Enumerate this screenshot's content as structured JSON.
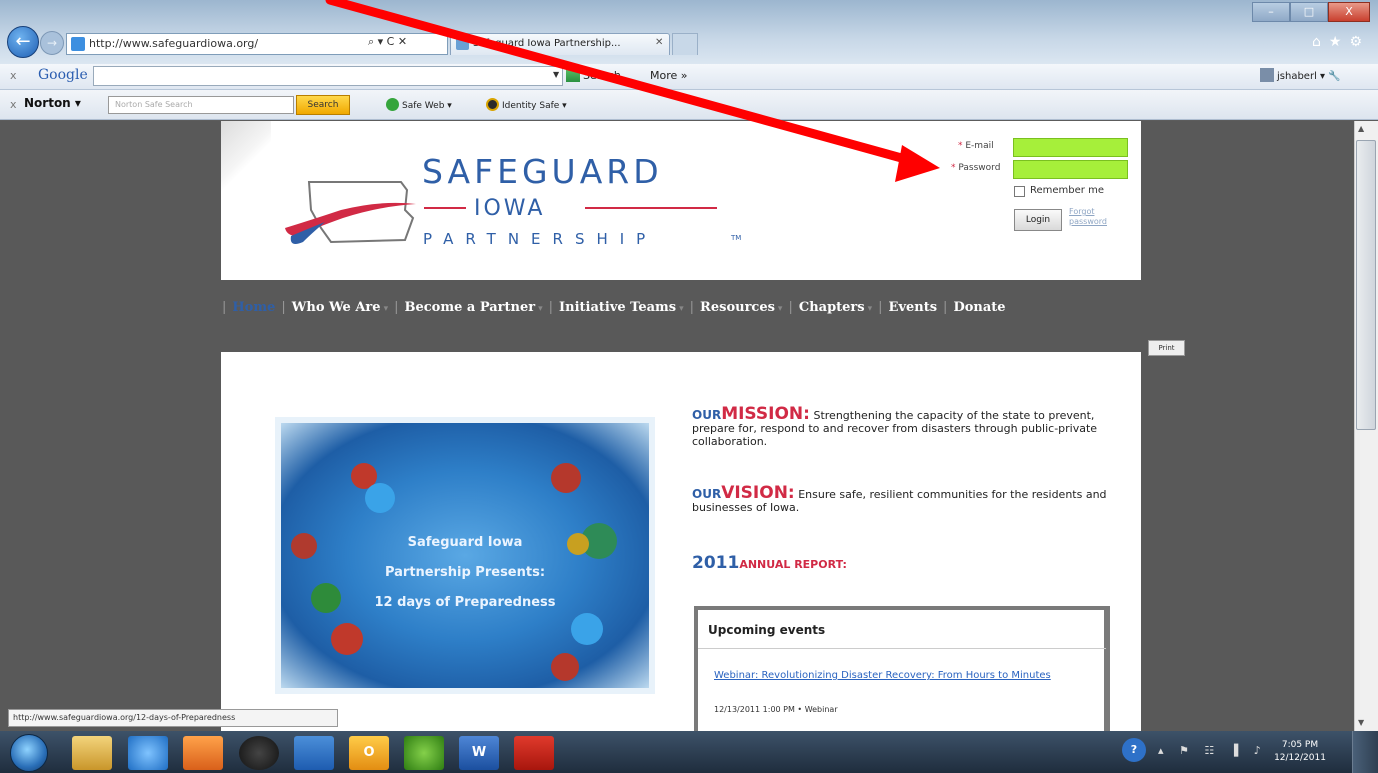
{
  "browser": {
    "address": "http://www.safeguardiowa.org/",
    "address_tools": "⌕ ▾ C ✕",
    "tab_title": "Safeguard Iowa Partnership...",
    "tab_close": "✕",
    "window_controls": {
      "min": "–",
      "max": "□",
      "close": "X"
    },
    "ie_icons": "⌂★⚙"
  },
  "google_toolbar": {
    "close": "x",
    "logo": "Google",
    "search_label": "Search",
    "more_label": "More »",
    "user_label": "jshaberl ▾"
  },
  "norton_toolbar": {
    "close": "x",
    "logo": "Norton ▾",
    "search_placeholder": "Norton Safe Search",
    "search_button": "Search",
    "safe_web": "Safe Web ▾",
    "identity_safe": "Identity Safe ▾"
  },
  "site": {
    "logo": {
      "title": "SAFEGUARD",
      "iowa": "IOWA",
      "partnership": "PARTNERSHIP",
      "tm": "TM"
    },
    "login": {
      "email_label": "E-mail",
      "password_label": "Password",
      "required_mark": "*",
      "remember_label": "Remember me",
      "login_button": "Login",
      "forgot_link": "Forgot password"
    },
    "nav": {
      "home": "Home",
      "who_we_are": "Who We Are",
      "become_partner": "Become a Partner",
      "initiative_teams": "Initiative Teams",
      "resources": "Resources",
      "chapters": "Chapters",
      "events": "Events",
      "donate": "Donate",
      "separator": "|",
      "caret": "▾"
    },
    "print_label": "Print",
    "hero": {
      "line1": "Safeguard Iowa",
      "line2": "Partnership Presents:",
      "line3": "12 days of Preparedness"
    },
    "mission": {
      "our": "OUR",
      "word": "MISSION:",
      "text": "Strengthening the capacity of the state to prevent, prepare for, respond to and recover from disasters through public-private collaboration."
    },
    "vision": {
      "our": "OUR",
      "word": "VISION:",
      "text": "Ensure safe, resilient communities for the residents and businesses of Iowa."
    },
    "annual_report": {
      "year": "2011",
      "label": "ANNUAL REPORT:"
    },
    "events": {
      "title": "Upcoming events",
      "items": [
        {
          "title": "Webinar: Revolutionizing Disaster Recovery: From Hours to Minutes",
          "meta": "12/13/2011 1:00 PM • Webinar"
        }
      ]
    }
  },
  "status_url": "http://www.safeguardiowa.org/12-days-of-Preparedness",
  "taskbar": {
    "word_label": "W",
    "outlook_label": "O",
    "time": "7:05 PM",
    "date": "12/12/2011",
    "help": "?",
    "tray_icons": "▴ ⚑ ☷ ▐ ♪"
  },
  "colors": {
    "brand_blue": "#2f5fa7",
    "brand_red": "#d12a45",
    "login_field_green": "#a6ef3a",
    "annotation_arrow": "#ff0000"
  }
}
